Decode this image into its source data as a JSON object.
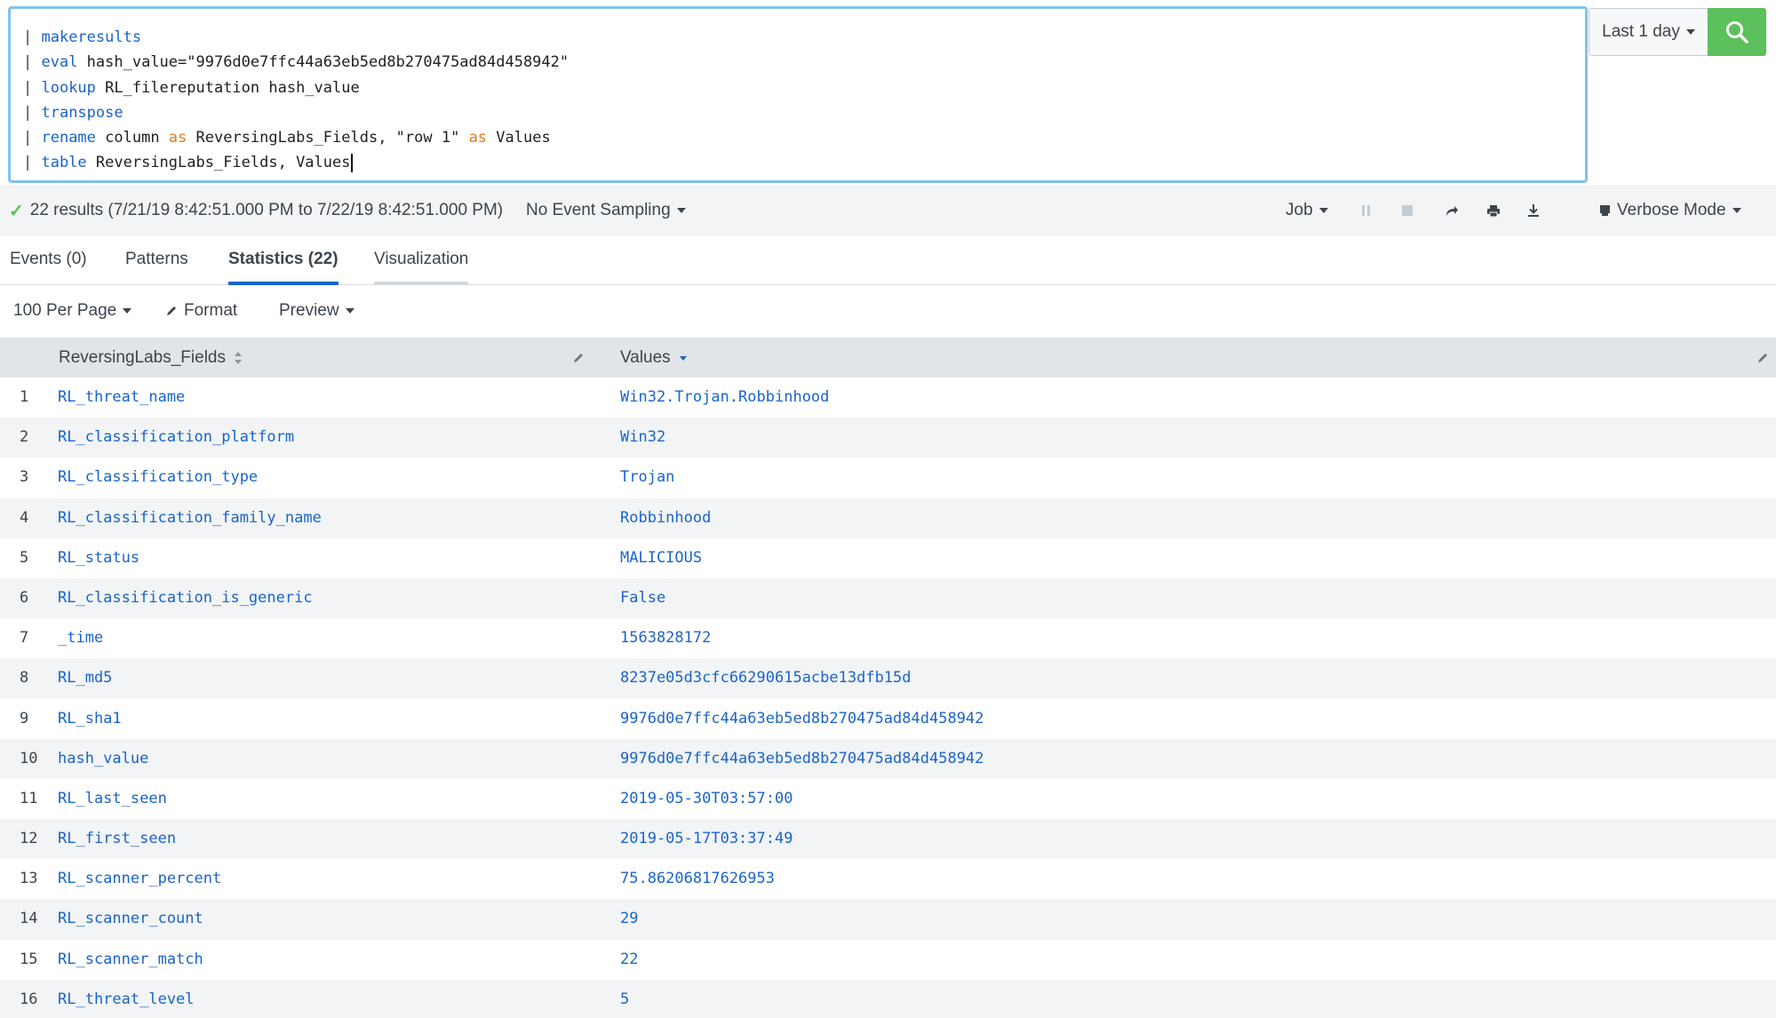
{
  "search": {
    "lines": [
      {
        "pipe": "| ",
        "cmd": "makeresults",
        "rest": ""
      },
      {
        "pipe": "| ",
        "cmd": "eval",
        "rest": " hash_value=\"9976d0e7ffc44a63eb5ed8b270475ad84d458942\""
      },
      {
        "pipe": "| ",
        "cmd": "lookup",
        "rest": " RL_filereputation hash_value"
      },
      {
        "pipe": "| ",
        "cmd": "transpose",
        "rest": ""
      },
      {
        "pipe": "| ",
        "cmd": "rename",
        "rest": " column ",
        "op1": "as",
        "rest2": " ReversingLabs_Fields, \"row 1\" ",
        "op2": "as",
        "rest3": " Values"
      },
      {
        "pipe": "| ",
        "cmd": "table",
        "rest": " ReversingLabs_Fields, Values"
      }
    ],
    "time_range": "Last 1 day"
  },
  "status": {
    "results": "22 results (7/21/19 8:42:51.000 PM to 7/22/19 8:42:51.000 PM)",
    "sampling": "No Event Sampling",
    "job": "Job",
    "mode": "Verbose Mode"
  },
  "tabs": [
    {
      "label": "Events (0)"
    },
    {
      "label": "Patterns"
    },
    {
      "label": "Statistics (22)"
    },
    {
      "label": "Visualization"
    }
  ],
  "toolbar": {
    "per_page": "100 Per Page",
    "format": "Format",
    "preview": "Preview"
  },
  "table": {
    "columns": [
      "ReversingLabs_Fields",
      "Values"
    ],
    "rows": [
      {
        "n": "1",
        "field": "RL_threat_name",
        "value": "Win32.Trojan.Robbinhood"
      },
      {
        "n": "2",
        "field": "RL_classification_platform",
        "value": "Win32"
      },
      {
        "n": "3",
        "field": "RL_classification_type",
        "value": "Trojan"
      },
      {
        "n": "4",
        "field": "RL_classification_family_name",
        "value": "Robbinhood"
      },
      {
        "n": "5",
        "field": "RL_status",
        "value": "MALICIOUS"
      },
      {
        "n": "6",
        "field": "RL_classification_is_generic",
        "value": "False"
      },
      {
        "n": "7",
        "field": "_time",
        "value": "1563828172"
      },
      {
        "n": "8",
        "field": "RL_md5",
        "value": "8237e05d3cfc66290615acbe13dfb15d"
      },
      {
        "n": "9",
        "field": "RL_sha1",
        "value": "9976d0e7ffc44a63eb5ed8b270475ad84d458942"
      },
      {
        "n": "10",
        "field": "hash_value",
        "value": "9976d0e7ffc44a63eb5ed8b270475ad84d458942"
      },
      {
        "n": "11",
        "field": "RL_last_seen",
        "value": "2019-05-30T03:57:00"
      },
      {
        "n": "12",
        "field": "RL_first_seen",
        "value": "2019-05-17T03:37:49"
      },
      {
        "n": "13",
        "field": "RL_scanner_percent",
        "value": "75.86206817626953"
      },
      {
        "n": "14",
        "field": "RL_scanner_count",
        "value": "29"
      },
      {
        "n": "15",
        "field": "RL_scanner_match",
        "value": "22"
      },
      {
        "n": "16",
        "field": "RL_threat_level",
        "value": "5"
      }
    ]
  },
  "colors": {
    "accent": "#1a64c8",
    "search_button": "#5cc05c",
    "keyword_operator": "#e07a1f"
  }
}
